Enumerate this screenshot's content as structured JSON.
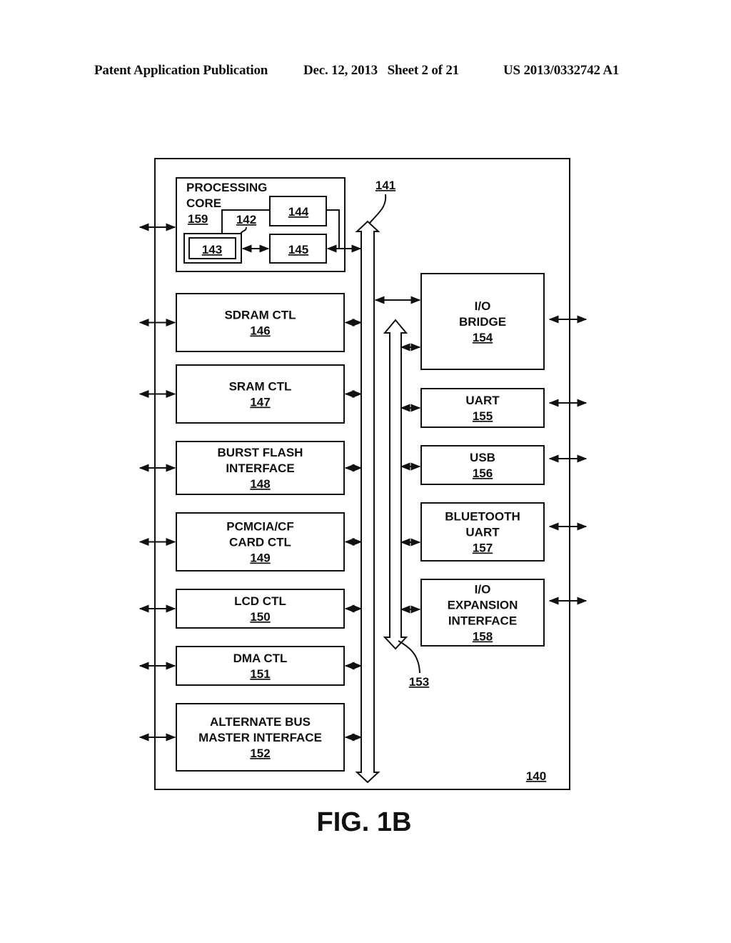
{
  "header": {
    "left": "Patent Application Publication",
    "center": "Dec. 12, 2013   Sheet 2 of 21",
    "right": "US 2013/0332742 A1"
  },
  "diagram": {
    "outer_ref": "140",
    "main_bus_ref": "141",
    "secondary_bus_ref": "153",
    "processing_core": {
      "title_line1": "PROCESSING",
      "title_line2": "CORE",
      "ref": "159",
      "sub_blocks": {
        "ref_142": "142",
        "ref_143": "143",
        "ref_144": "144",
        "ref_145": "145"
      }
    },
    "left_blocks": [
      {
        "lines": [
          "SDRAM CTL"
        ],
        "ref": "146"
      },
      {
        "lines": [
          "SRAM CTL"
        ],
        "ref": "147"
      },
      {
        "lines": [
          "BURST FLASH",
          "INTERFACE"
        ],
        "ref": "148"
      },
      {
        "lines": [
          "PCMCIA/CF",
          "CARD CTL"
        ],
        "ref": "149"
      },
      {
        "lines": [
          "LCD CTL"
        ],
        "ref": "150"
      },
      {
        "lines": [
          "DMA CTL"
        ],
        "ref": "151"
      },
      {
        "lines": [
          "ALTERNATE BUS",
          "MASTER INTERFACE"
        ],
        "ref": "152"
      }
    ],
    "right_blocks": [
      {
        "lines": [
          "I/O",
          "BRIDGE"
        ],
        "ref": "154"
      },
      {
        "lines": [
          "UART"
        ],
        "ref": "155"
      },
      {
        "lines": [
          "USB"
        ],
        "ref": "156"
      },
      {
        "lines": [
          "BLUETOOTH",
          "UART"
        ],
        "ref": "157"
      },
      {
        "lines": [
          "I/O",
          "EXPANSION",
          "INTERFACE"
        ],
        "ref": "158"
      }
    ]
  },
  "figure_label": "FIG. 1B"
}
